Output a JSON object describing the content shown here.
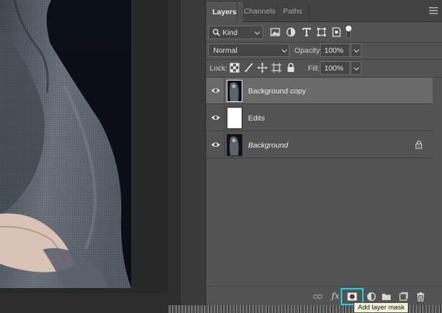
{
  "panel": {
    "tabs": [
      {
        "label": "Layers",
        "active": true
      },
      {
        "label": "Channels",
        "active": false
      },
      {
        "label": "Paths",
        "active": false
      }
    ],
    "menu_icon": "hamburger-icon"
  },
  "filter": {
    "kind_label": "Kind",
    "icons": [
      "pixel-filter-icon",
      "adjustment-filter-icon",
      "type-filter-icon",
      "shape-filter-icon",
      "smart-object-filter-icon",
      "filter-toggle-icon"
    ]
  },
  "blend": {
    "mode": "Normal",
    "opacity_label": "Opacity:",
    "opacity_value": "100%"
  },
  "lock": {
    "label": "Lock:",
    "icons": [
      "lock-transparent-icon",
      "lock-image-icon",
      "lock-position-icon",
      "lock-artboard-icon",
      "lock-all-icon"
    ],
    "fill_label": "Fill:",
    "fill_value": "100%"
  },
  "layers": [
    {
      "name": "Background copy",
      "visible": true,
      "selected": true,
      "thumb": "photo",
      "italic": false,
      "locked": false
    },
    {
      "name": "Edits",
      "visible": true,
      "selected": false,
      "thumb": "white",
      "italic": false,
      "locked": false
    },
    {
      "name": "Background",
      "visible": true,
      "selected": false,
      "thumb": "photo",
      "italic": true,
      "locked": true
    }
  ],
  "bottom_bar": {
    "icons": [
      "link-layers-icon",
      "fx-icon",
      "add-layer-mask-icon",
      "adjustment-layer-icon",
      "new-group-icon",
      "new-layer-icon",
      "trash-icon"
    ],
    "fx_label": "fx",
    "highlighted": "add-layer-mask-icon"
  },
  "tooltip": "Add layer mask",
  "colors": {
    "panel_bg": "#535353",
    "selected_row": "#6a6a6a",
    "highlight": "#19d7ea"
  }
}
